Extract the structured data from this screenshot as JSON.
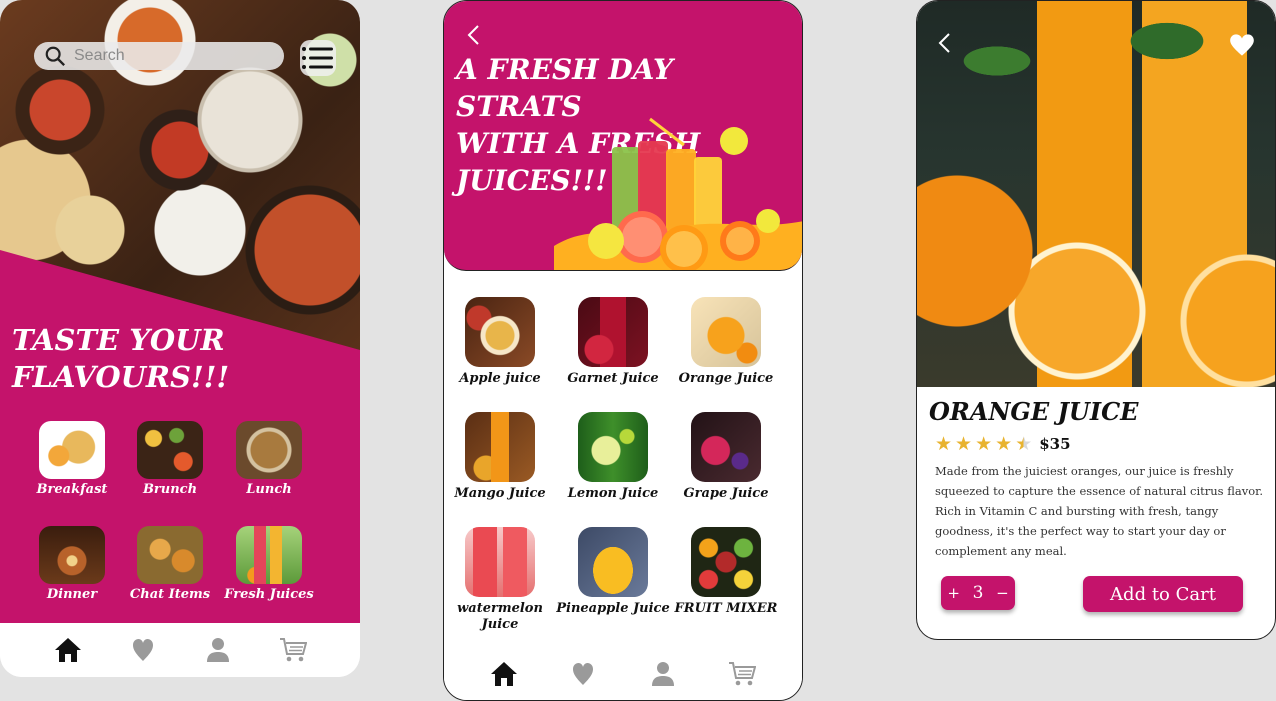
{
  "colors": {
    "accent": "#c4136b",
    "nav_active": "#111111",
    "nav_inactive": "#9a9a9a",
    "star": "#e8b32f"
  },
  "screen1": {
    "search": {
      "placeholder": "Search",
      "icon": "search-icon"
    },
    "menu_icon": "list-menu-icon",
    "headline_line1": "TASTE YOUR",
    "headline_line2": "FLAVOURS!!!",
    "categories": [
      {
        "label": "Breakfast",
        "color": "#f4e3b0"
      },
      {
        "label": "Brunch",
        "color": "#8a4a2a"
      },
      {
        "label": "Lunch",
        "color": "#6b4a2c"
      },
      {
        "label": "Dinner",
        "color": "#5a2e16"
      },
      {
        "label": "Chat Items",
        "color": "#c99a3e"
      },
      {
        "label": "Fresh Juices",
        "color": "#79b650"
      }
    ],
    "nav": [
      "home-icon",
      "heart-icon",
      "profile-icon",
      "cart-icon"
    ]
  },
  "screen2": {
    "back_icon": "chevron-left-icon",
    "headline_line1": "A FRESH DAY STRATS",
    "headline_line2": "WITH A FRESH",
    "headline_line3": "JUICES!!!",
    "juices": [
      {
        "label": "Apple juice",
        "color": "#6f3b20"
      },
      {
        "label": "Garnet Juice",
        "color": "#8c1325"
      },
      {
        "label": "Orange Juice",
        "color": "#f2a12a"
      },
      {
        "label": "Mango Juice",
        "color": "#d9771a"
      },
      {
        "label": "Lemon Juice",
        "color": "#3d8a2a"
      },
      {
        "label": "Grape Juice",
        "color": "#3a1f2a"
      },
      {
        "label": "watermelon Juice",
        "color": "#e5484d"
      },
      {
        "label": "Pineapple Juice",
        "color": "#f5b81e"
      },
      {
        "label": "FRUIT MIXER",
        "color": "#2b3a1c"
      }
    ],
    "nav": [
      "home-icon",
      "heart-icon",
      "profile-icon",
      "cart-icon"
    ]
  },
  "screen3": {
    "back_icon": "chevron-left-icon",
    "favorite_icon": "heart-icon",
    "title": "ORANGE JUICE",
    "rating": 4.5,
    "price": "$35",
    "description": "Made from the juiciest oranges, our juice is freshly squeezed to capture the essence of natural citrus flavor. Rich in Vitamin C and bursting with fresh, tangy goodness, it's the perfect way to start your day or complement any meal.",
    "quantity": {
      "plus": "+",
      "value": "3",
      "minus": "−"
    },
    "add_to_cart": "Add to Cart"
  }
}
